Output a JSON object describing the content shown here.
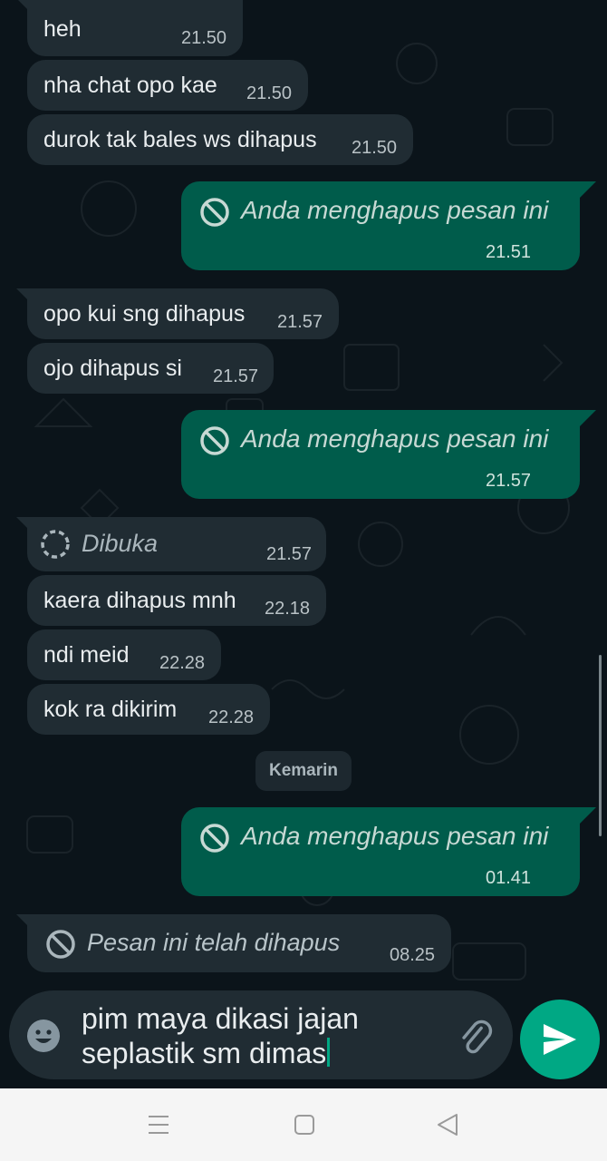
{
  "messages": [
    {
      "kind": "in",
      "text": "heh",
      "time": "21.50"
    },
    {
      "kind": "in",
      "text": "nha chat opo kae",
      "time": "21.50"
    },
    {
      "kind": "in",
      "text": "durok tak bales ws dihapus",
      "time": "21.50"
    },
    {
      "kind": "out-deleted",
      "text": "Anda menghapus pesan ini",
      "time": "21.51"
    },
    {
      "kind": "in",
      "text": "opo kui sng dihapus",
      "time": "21.57"
    },
    {
      "kind": "in",
      "text": "ojo dihapus si",
      "time": "21.57"
    },
    {
      "kind": "out-deleted",
      "text": "Anda menghapus pesan ini",
      "time": "21.57"
    },
    {
      "kind": "in-viewonce",
      "text": "Dibuka",
      "time": "21.57"
    },
    {
      "kind": "in",
      "text": "kaera dihapus mnh",
      "time": "22.18"
    },
    {
      "kind": "in",
      "text": "ndi meid",
      "time": "22.28"
    },
    {
      "kind": "in",
      "text": "kok ra dikirim",
      "time": "22.28"
    },
    {
      "kind": "date",
      "text": "Kemarin"
    },
    {
      "kind": "out-deleted",
      "text": "Anda menghapus pesan ini",
      "time": "01.41"
    },
    {
      "kind": "in-deleted",
      "text": "Pesan ini telah dihapus",
      "time": "08.25"
    }
  ],
  "composer": {
    "line1": "pim maya dikasi jajan",
    "line2": "seplastik sm dimas",
    "emoji_icon": "emoji-icon",
    "attach_icon": "paperclip-icon",
    "send_icon": "send-icon"
  },
  "navbar": {
    "icons": [
      "menu-icon",
      "home-square-icon",
      "back-triangle-icon"
    ]
  },
  "colors": {
    "incoming": "#202c33",
    "outgoing": "#005c4b",
    "accent": "#00a884",
    "background": "#0b141a"
  }
}
